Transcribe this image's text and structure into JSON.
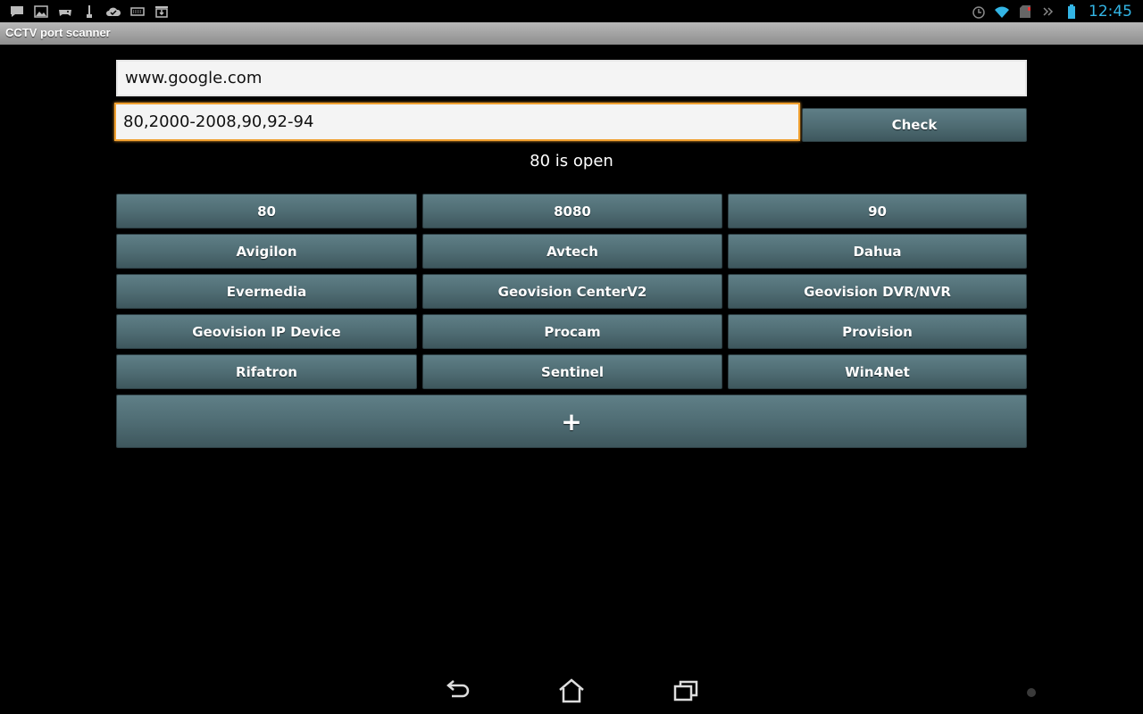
{
  "status_bar": {
    "time": "12:45",
    "left_icons": [
      "message-icon",
      "image-icon",
      "gamepad-icon",
      "usb-icon",
      "cloud-check-icon",
      "keyboard-icon",
      "download-icon"
    ],
    "right_icons": [
      "alarm-icon",
      "wifi-icon",
      "sd-card-icon",
      "chevron-right-icon",
      "battery-icon"
    ],
    "accent_color": "#33b5e5"
  },
  "app": {
    "title": "CCTV port scanner"
  },
  "form": {
    "host_value": "www.google.com",
    "ports_value": "80,2000-2008,90,92-94",
    "check_label": "Check",
    "focus_color": "#f0a030"
  },
  "result": {
    "text": "80 is open"
  },
  "presets": [
    {
      "label": "80"
    },
    {
      "label": "8080"
    },
    {
      "label": "90"
    },
    {
      "label": "Avigilon"
    },
    {
      "label": "Avtech"
    },
    {
      "label": "Dahua"
    },
    {
      "label": "Evermedia"
    },
    {
      "label": "Geovision CenterV2"
    },
    {
      "label": "Geovision DVR/NVR"
    },
    {
      "label": "Geovision IP Device"
    },
    {
      "label": "Procam"
    },
    {
      "label": "Provision"
    },
    {
      "label": "Rifatron"
    },
    {
      "label": "Sentinel"
    },
    {
      "label": "Win4Net"
    }
  ],
  "add_button": {
    "label": "+"
  },
  "nav_bar": {
    "buttons": [
      "back-icon",
      "home-icon",
      "recent-apps-icon"
    ]
  }
}
